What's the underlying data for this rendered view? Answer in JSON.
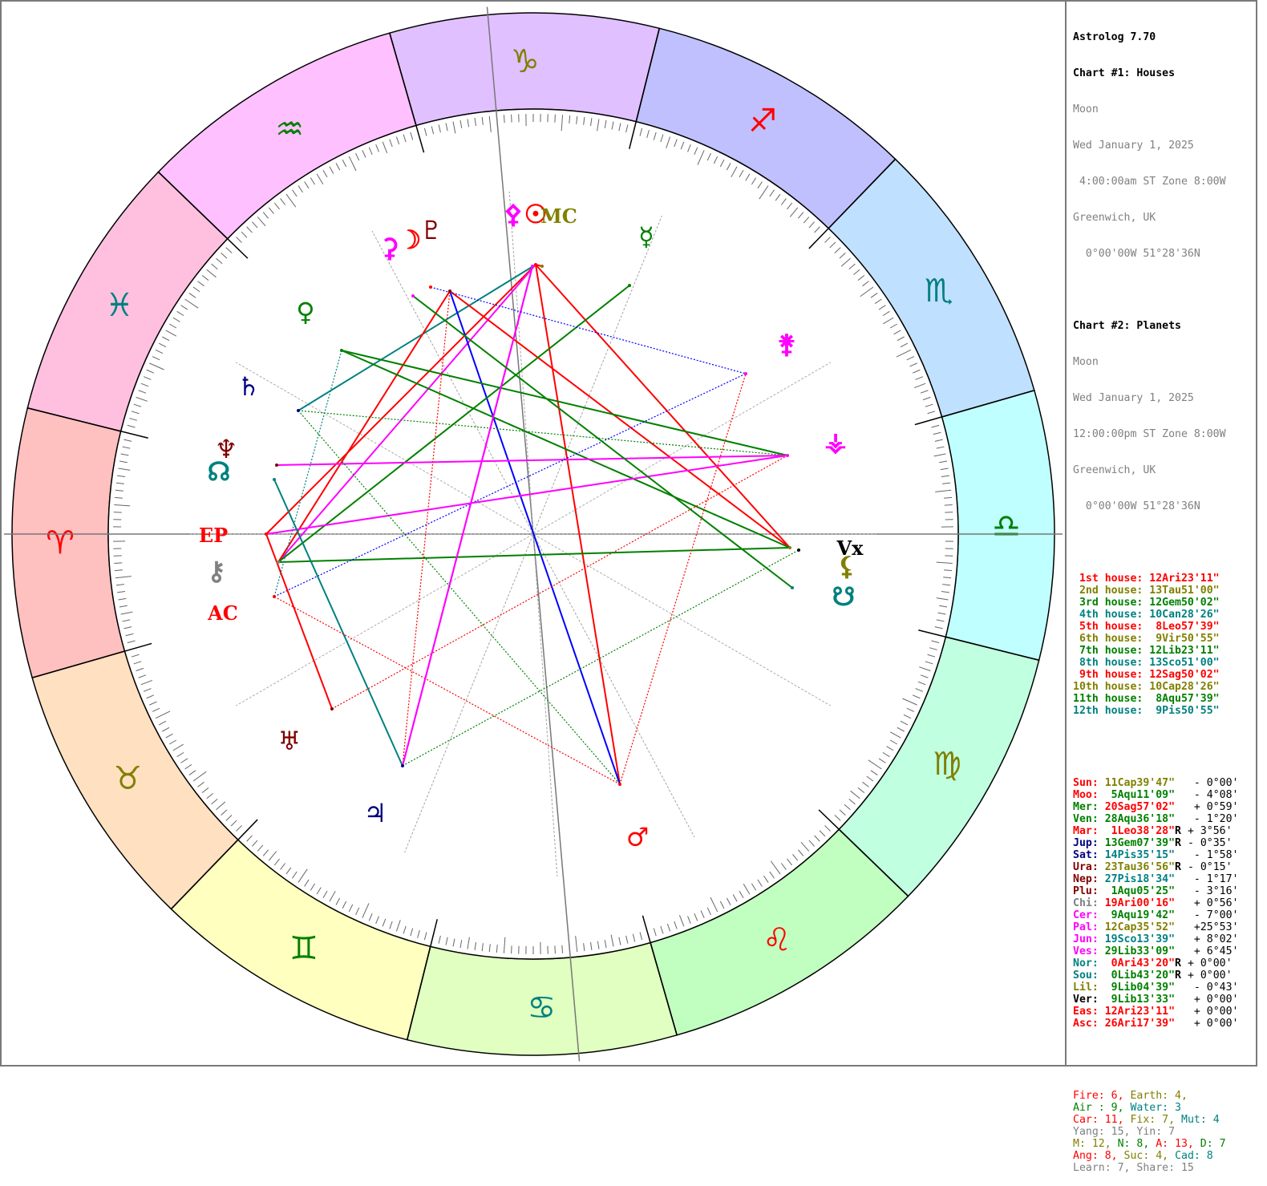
{
  "chart_header": {
    "program": "Astrolog 7.70",
    "chart1": {
      "title": "Chart #1: Houses",
      "name": "Moon",
      "date": "Wed January 1, 2025",
      "time": " 4:00:00am ST Zone 8:00W",
      "place": "Greenwich, UK",
      "coords": "  0°00'00W 51°28'36N"
    },
    "chart2": {
      "title": "Chart #2: Planets",
      "name": "Moon",
      "date": "Wed January 1, 2025",
      "time": "12:00:00pm ST Zone 8:00W",
      "place": "Greenwich, UK",
      "coords": "  0°00'00W 51°28'36N"
    }
  },
  "houses": [
    {
      "label": " 1st house:",
      "value": " 12Ari23'11\"",
      "color": "#ff0000"
    },
    {
      "label": " 2nd house:",
      "value": " 13Tau51'00\"",
      "color": "#808000"
    },
    {
      "label": " 3rd house:",
      "value": " 12Gem50'02\"",
      "color": "#008000"
    },
    {
      "label": " 4th house:",
      "value": " 10Can28'26\"",
      "color": "#008080"
    },
    {
      "label": " 5th house:",
      "value": "  8Leo57'39\"",
      "color": "#ff0000"
    },
    {
      "label": " 6th house:",
      "value": "  9Vir50'55\"",
      "color": "#808000"
    },
    {
      "label": " 7th house:",
      "value": " 12Lib23'11\"",
      "color": "#008000"
    },
    {
      "label": " 8th house:",
      "value": " 13Sco51'00\"",
      "color": "#008080"
    },
    {
      "label": " 9th house:",
      "value": " 12Sag50'02\"",
      "color": "#ff0000"
    },
    {
      "label": "10th house:",
      "value": " 10Cap28'26\"",
      "color": "#808000"
    },
    {
      "label": "11th house:",
      "value": "  8Aqu57'39\"",
      "color": "#008000"
    },
    {
      "label": "12th house:",
      "value": "  9Pis50'55\"",
      "color": "#008080"
    }
  ],
  "planets": [
    {
      "name": "Sun:",
      "pos": " 11Cap39'47\"",
      "retro": " ",
      "lat": "  - 0°00'",
      "color": "#ff0000",
      "pos_color": "#808000"
    },
    {
      "name": "Moo:",
      "pos": "  5Aqu11'09\"",
      "retro": " ",
      "lat": "  - 4°08'",
      "color": "#ff0000",
      "pos_color": "#008000"
    },
    {
      "name": "Mer:",
      "pos": " 20Sag57'02\"",
      "retro": " ",
      "lat": "  + 0°59'",
      "color": "#008000",
      "pos_color": "#ff0000"
    },
    {
      "name": "Ven:",
      "pos": " 28Aqu36'18\"",
      "retro": " ",
      "lat": "  - 1°20'",
      "color": "#008000",
      "pos_color": "#008000"
    },
    {
      "name": "Mar:",
      "pos": "  1Leo38'28\"",
      "retro": "R",
      "lat": " + 3°56'",
      "color": "#ff0000",
      "pos_color": "#ff0000"
    },
    {
      "name": "Jup:",
      "pos": " 13Gem07'39\"",
      "retro": "R",
      "lat": " - 0°35'",
      "color": "#000080",
      "pos_color": "#008000"
    },
    {
      "name": "Sat:",
      "pos": " 14Pis35'15\"",
      "retro": " ",
      "lat": "  - 1°58'",
      "color": "#000080",
      "pos_color": "#008080"
    },
    {
      "name": "Ura:",
      "pos": " 23Tau36'56\"",
      "retro": "R",
      "lat": " - 0°15'",
      "color": "#800000",
      "pos_color": "#808000"
    },
    {
      "name": "Nep:",
      "pos": " 27Pis18'34\"",
      "retro": " ",
      "lat": "  - 1°17'",
      "color": "#800000",
      "pos_color": "#008080"
    },
    {
      "name": "Plu:",
      "pos": "  1Aqu05'25\"",
      "retro": " ",
      "lat": "  - 3°16'",
      "color": "#800000",
      "pos_color": "#008000"
    },
    {
      "name": "Chi:",
      "pos": " 19Ari00'16\"",
      "retro": " ",
      "lat": "  + 0°56'",
      "color": "#808080",
      "pos_color": "#ff0000"
    },
    {
      "name": "Cer:",
      "pos": "  9Aqu19'42\"",
      "retro": " ",
      "lat": "  - 7°00'",
      "color": "#ff00ff",
      "pos_color": "#008000"
    },
    {
      "name": "Pal:",
      "pos": " 12Cap35'52\"",
      "retro": " ",
      "lat": "  +25°53'",
      "color": "#ff00ff",
      "pos_color": "#808000"
    },
    {
      "name": "Jun:",
      "pos": " 19Sco13'39\"",
      "retro": " ",
      "lat": "  + 8°02'",
      "color": "#ff00ff",
      "pos_color": "#008080"
    },
    {
      "name": "Ves:",
      "pos": " 29Lib33'09\"",
      "retro": " ",
      "lat": "  + 6°45'",
      "color": "#ff00ff",
      "pos_color": "#008000"
    },
    {
      "name": "Nor:",
      "pos": "  0Ari43'20\"",
      "retro": "R",
      "lat": " + 0°00'",
      "color": "#008080",
      "pos_color": "#ff0000"
    },
    {
      "name": "Sou:",
      "pos": "  0Lib43'20\"",
      "retro": "R",
      "lat": " + 0°00'",
      "color": "#008080",
      "pos_color": "#008000"
    },
    {
      "name": "Lil:",
      "pos": "  9Lib04'39\"",
      "retro": " ",
      "lat": "  - 0°43'",
      "color": "#808000",
      "pos_color": "#008000"
    },
    {
      "name": "Ver:",
      "pos": "  9Lib13'33\"",
      "retro": " ",
      "lat": "  + 0°00'",
      "color": "#000000",
      "pos_color": "#008000"
    },
    {
      "name": "Eas:",
      "pos": " 12Ari23'11\"",
      "retro": " ",
      "lat": "  + 0°00'",
      "color": "#ff0000",
      "pos_color": "#ff0000"
    },
    {
      "name": "Asc:",
      "pos": " 26Ari17'39\"",
      "retro": " ",
      "lat": "  + 0°00'",
      "color": "#ff0000",
      "pos_color": "#ff0000"
    }
  ],
  "summary": [
    [
      {
        "t": "Fire: 6, ",
        "c": "#ff0000"
      },
      {
        "t": "Earth: 4,",
        "c": "#808000"
      }
    ],
    [
      {
        "t": "Air : 9, ",
        "c": "#008000"
      },
      {
        "t": "Water: 3",
        "c": "#008080"
      }
    ],
    [
      {
        "t": "Car: 11, ",
        "c": "#ff0000"
      },
      {
        "t": "Fix: 7, ",
        "c": "#808000"
      },
      {
        "t": "Mut: 4",
        "c": "#008080"
      }
    ],
    [
      {
        "t": "Yang: 15, Yin: 7",
        "c": "#808080"
      }
    ],
    [
      {
        "t": "M: 12, ",
        "c": "#808000"
      },
      {
        "t": "N: 8, ",
        "c": "#008000"
      },
      {
        "t": "A: 13, ",
        "c": "#ff0000"
      },
      {
        "t": "D: 7",
        "c": "#008000"
      }
    ],
    [
      {
        "t": "Ang: 8, ",
        "c": "#ff0000"
      },
      {
        "t": "Suc: 4, ",
        "c": "#808000"
      },
      {
        "t": "Cad: 8",
        "c": "#008080"
      }
    ],
    [
      {
        "t": "Learn: 7, Share: 15",
        "c": "#808080"
      }
    ]
  ],
  "wheel": {
    "signs": [
      {
        "glyph": "♈",
        "color": "#ff0000",
        "bg": "#ffc0c0"
      },
      {
        "glyph": "♉",
        "color": "#808000",
        "bg": "#ffe0c0"
      },
      {
        "glyph": "♊",
        "color": "#008000",
        "bg": "#ffffc0"
      },
      {
        "glyph": "♋",
        "color": "#008080",
        "bg": "#e0ffc0"
      },
      {
        "glyph": "♌",
        "color": "#ff0000",
        "bg": "#c0ffc0"
      },
      {
        "glyph": "♍",
        "color": "#808000",
        "bg": "#c0ffe0"
      },
      {
        "glyph": "♎",
        "color": "#008000",
        "bg": "#c0ffff"
      },
      {
        "glyph": "♏",
        "color": "#008080",
        "bg": "#c0e0ff"
      },
      {
        "glyph": "♐",
        "color": "#ff0000",
        "bg": "#c0c0ff"
      },
      {
        "glyph": "♑",
        "color": "#808000",
        "bg": "#e0c0ff"
      },
      {
        "glyph": "♒",
        "color": "#008000",
        "bg": "#ffc0ff"
      },
      {
        "glyph": "♓",
        "color": "#008080",
        "bg": "#ffc0e0"
      }
    ],
    "house_numbers": [
      {
        "n": "1",
        "color": "#ff0000"
      },
      {
        "n": "2",
        "color": "#808000"
      },
      {
        "n": "3",
        "color": "#008000"
      },
      {
        "n": "4",
        "color": "#008080"
      },
      {
        "n": "5",
        "color": "#ff0000"
      },
      {
        "n": "6",
        "color": "#808000"
      },
      {
        "n": "7",
        "color": "#008000"
      },
      {
        "n": "8",
        "color": "#008080"
      },
      {
        "n": "9",
        "color": "#ff0000"
      },
      {
        "n": "10",
        "color": "#808000"
      },
      {
        "n": "11",
        "color": "#008000"
      },
      {
        "n": "12",
        "color": "#008080"
      }
    ],
    "points": [
      {
        "glyph": "☉",
        "color": "#ff0000",
        "lon": 281.66
      },
      {
        "glyph": "☽",
        "color": "#ff0000",
        "lon": 305.19
      },
      {
        "glyph": "☿",
        "color": "#008000",
        "lon": 260.95
      },
      {
        "glyph": "♀",
        "color": "#008000",
        "lon": 328.61
      },
      {
        "glyph": "♂",
        "color": "#ff0000",
        "lon": 121.64
      },
      {
        "glyph": "♃",
        "color": "#000080",
        "lon": 73.13
      },
      {
        "glyph": "♄",
        "color": "#000080",
        "lon": 344.59
      },
      {
        "glyph": "♅",
        "color": "#800000",
        "lon": 53.62
      },
      {
        "glyph": "♆",
        "color": "#800000",
        "lon": 357.31
      },
      {
        "glyph": "♇",
        "color": "#800000",
        "lon": 301.09
      },
      {
        "glyph": "⚷",
        "color": "#808080",
        "lon": 19.0
      },
      {
        "glyph": "⚳",
        "color": "#ff00ff",
        "lon": 309.33
      },
      {
        "glyph": "⚴",
        "color": "#ff00ff",
        "lon": 282.6
      },
      {
        "glyph": "⚵",
        "color": "#ff00ff",
        "lon": 229.23
      },
      {
        "glyph": "⚶",
        "color": "#ff00ff",
        "lon": 209.55
      },
      {
        "glyph": "☊",
        "color": "#008080",
        "lon": 0.72
      },
      {
        "glyph": "☋",
        "color": "#008080",
        "lon": 180.72
      },
      {
        "glyph": "⚸",
        "color": "#808000",
        "lon": 189.08
      },
      {
        "glyph": "Vx",
        "color": "#000000",
        "lon": 189.23
      },
      {
        "glyph": "EP",
        "color": "#ff0000",
        "lon": 12.39
      },
      {
        "glyph": "AC",
        "color": "#ff0000",
        "lon": 26.29
      },
      {
        "glyph": "MC",
        "color": "#808000",
        "lon": 280.47
      }
    ]
  }
}
